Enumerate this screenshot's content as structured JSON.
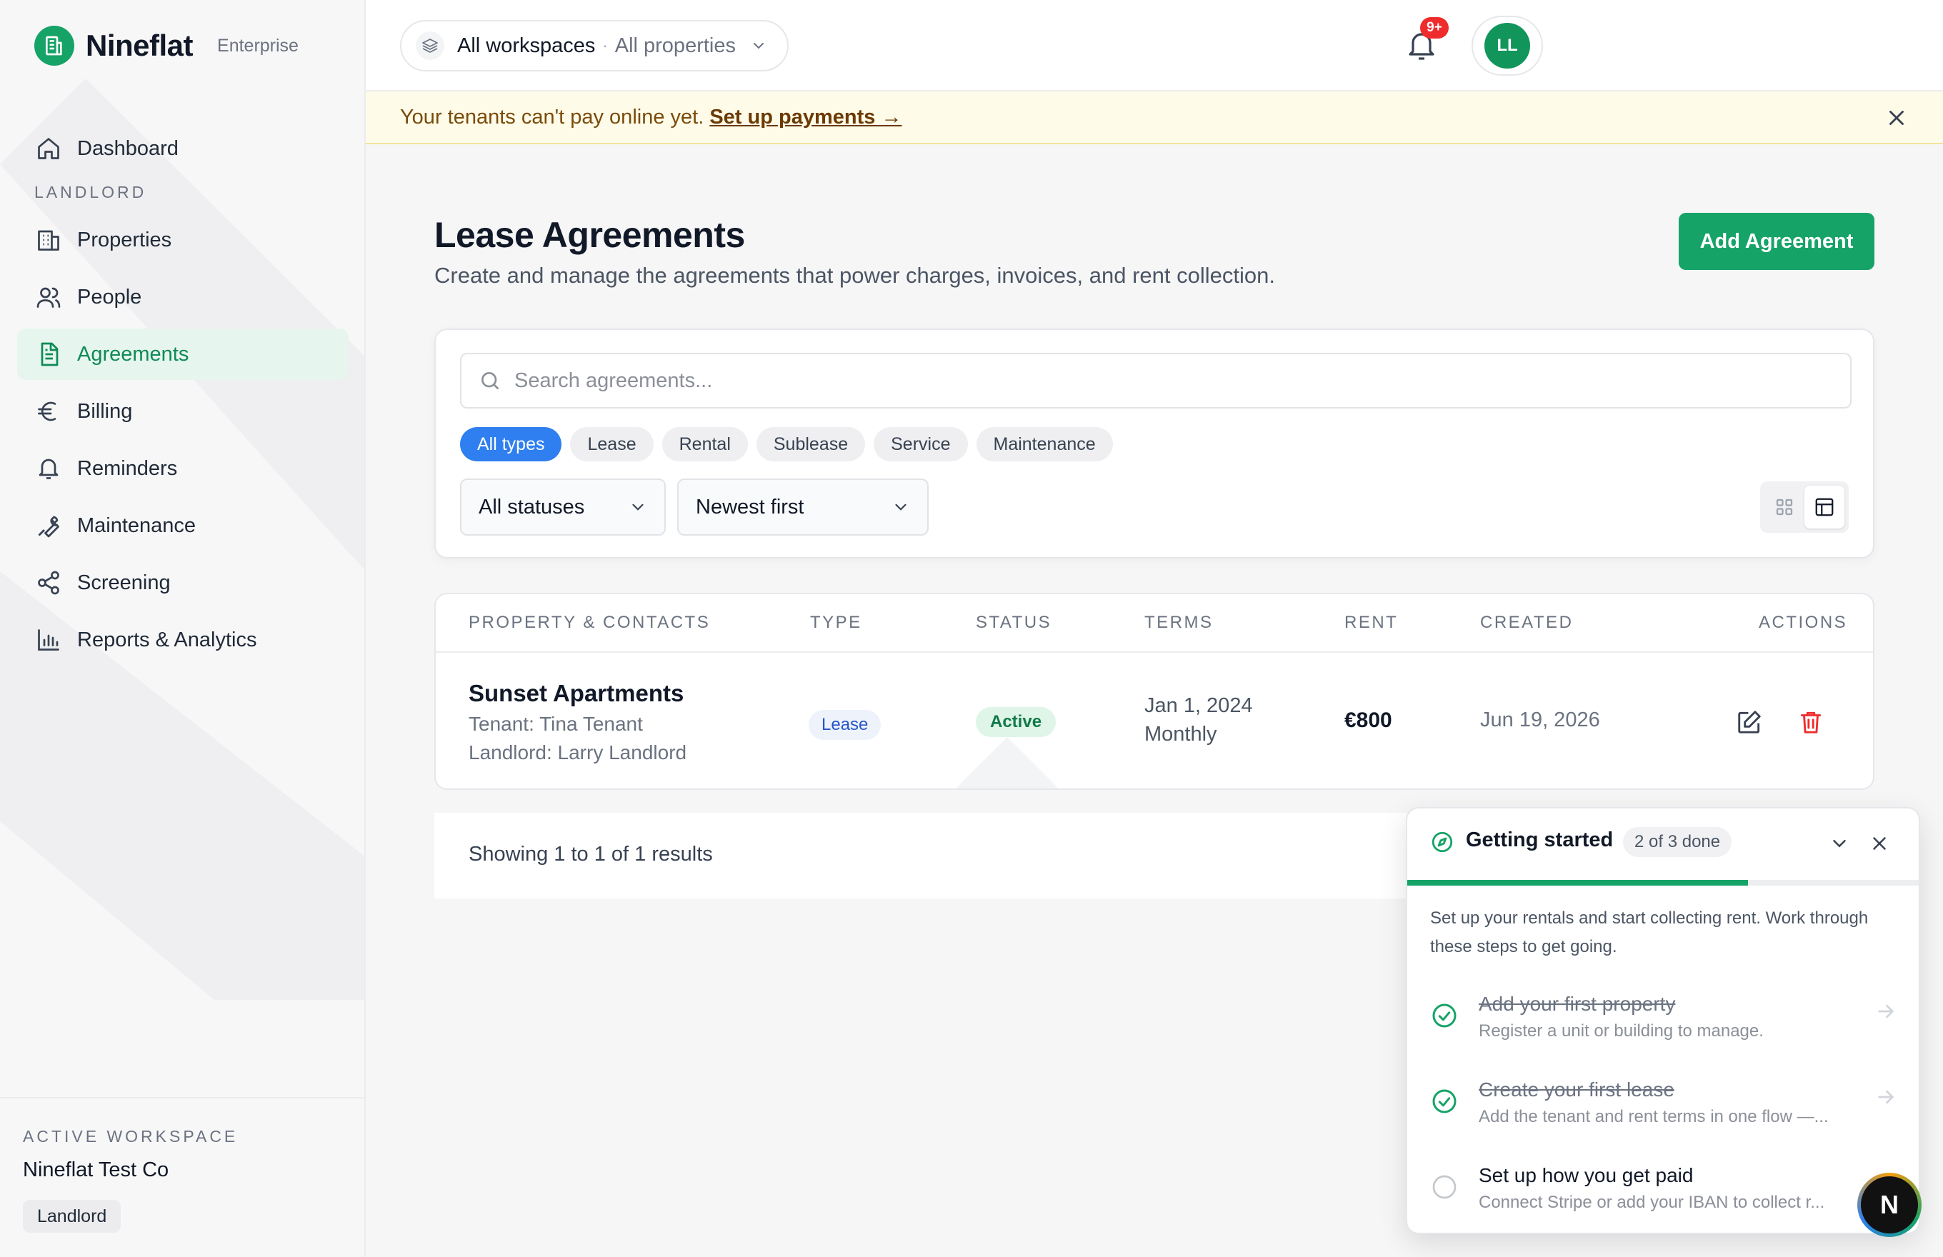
{
  "brand": {
    "name": "Nineflat",
    "tier": "Enterprise"
  },
  "nav": {
    "dashboard": "Dashboard",
    "section_landlord": "LANDLORD",
    "properties": "Properties",
    "people": "People",
    "agreements": "Agreements",
    "billing": "Billing",
    "reminders": "Reminders",
    "maintenance": "Maintenance",
    "screening": "Screening",
    "reports": "Reports & Analytics",
    "active_item": "Agreements"
  },
  "workspace": {
    "label": "ACTIVE WORKSPACE",
    "name": "Nineflat Test Co",
    "role": "Landlord"
  },
  "topbar": {
    "scope_workspace": "All workspaces",
    "scope_separator": "·",
    "scope_property": "All properties",
    "notifications_badge": "9+",
    "avatar_initials": "LL"
  },
  "banner": {
    "text": "Your tenants can't pay online yet.",
    "link": "Set up payments →"
  },
  "page": {
    "title": "Lease Agreements",
    "subtitle": "Create and manage the agreements that power charges, invoices, and rent collection.",
    "add_button": "Add Agreement"
  },
  "filters": {
    "search_placeholder": "Search agreements...",
    "search_value": "",
    "types": [
      "All types",
      "Lease",
      "Rental",
      "Sublease",
      "Service",
      "Maintenance"
    ],
    "selected_type": "All types",
    "status_select": "All statuses",
    "sort_select": "Newest first",
    "view_mode": "table"
  },
  "table": {
    "headers": [
      "PROPERTY & CONTACTS",
      "TYPE",
      "STATUS",
      "TERMS",
      "RENT",
      "CREATED",
      "ACTIONS"
    ],
    "rows": [
      {
        "property": "Sunset Apartments",
        "tenant": "Tenant: Tina Tenant",
        "landlord": "Landlord: Larry Landlord",
        "type": "Lease",
        "status": "Active",
        "terms_start": "Jan 1, 2024",
        "terms_frequency": "Monthly",
        "rent": "€800",
        "created": "Jun 19, 2026"
      }
    ]
  },
  "pagination": {
    "summary": "Showing 1 to 1 of 1 results"
  },
  "getting_started": {
    "title": "Getting started",
    "progress_label": "2 of 3 done",
    "progress_fraction": 0.6667,
    "description": "Set up your rentals and start collecting rent. Work through these steps to get going.",
    "steps": [
      {
        "title": "Add your first property",
        "subtitle": "Register a unit or building to manage.",
        "done": true
      },
      {
        "title": "Create your first lease",
        "subtitle": "Add the tenant and rent terms in one flow —...",
        "done": true
      },
      {
        "title": "Set up how you get paid",
        "subtitle": "Connect Stripe or add your IBAN to collect r...",
        "done": false
      }
    ]
  },
  "assistant_button": "N",
  "colors": {
    "accent_green": "#16a367",
    "active_chip_blue": "#2f7ff0",
    "banner_bg": "#fefbe8",
    "danger_red": "#ef2b2b"
  }
}
